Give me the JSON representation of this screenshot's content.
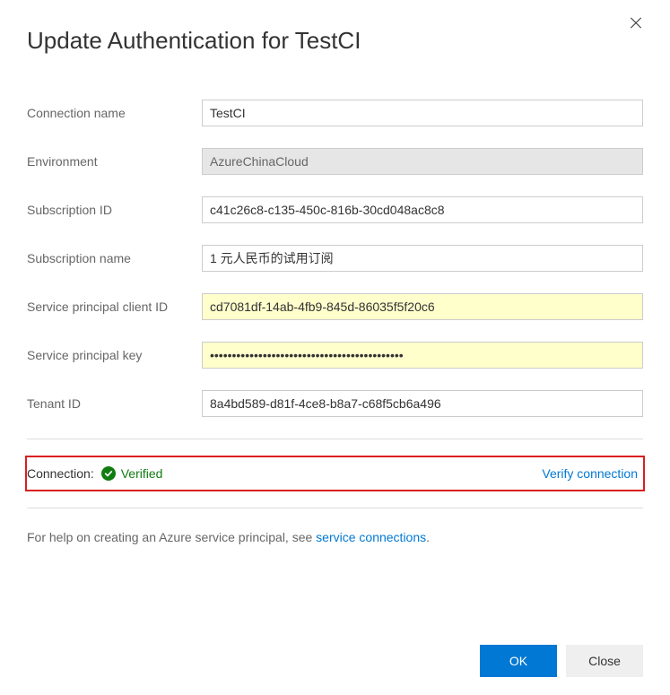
{
  "title": "Update Authentication for TestCI",
  "fields": {
    "connection_name": {
      "label": "Connection name",
      "value": "TestCI"
    },
    "environment": {
      "label": "Environment",
      "value": "AzureChinaCloud"
    },
    "subscription_id": {
      "label": "Subscription ID",
      "value": "c41c26c8-c135-450c-816b-30cd048ac8c8"
    },
    "subscription_name": {
      "label": "Subscription name",
      "value": "1 元人民币的试用订阅"
    },
    "sp_client_id": {
      "label": "Service principal client ID",
      "value": "cd7081df-14ab-4fb9-845d-86035f5f20c6"
    },
    "sp_key": {
      "label": "Service principal key",
      "value": "••••••••••••••••••••••••••••••••••••••••••••"
    },
    "tenant_id": {
      "label": "Tenant ID",
      "value": "8a4bd589-d81f-4ce8-b8a7-c68f5cb6a496"
    }
  },
  "connection_status": {
    "label": "Connection:",
    "status_text": "Verified",
    "verify_link": "Verify connection"
  },
  "help": {
    "prefix": "For help on creating an Azure service principal, see ",
    "link_text": "service connections",
    "suffix": "."
  },
  "buttons": {
    "ok": "OK",
    "close": "Close"
  }
}
